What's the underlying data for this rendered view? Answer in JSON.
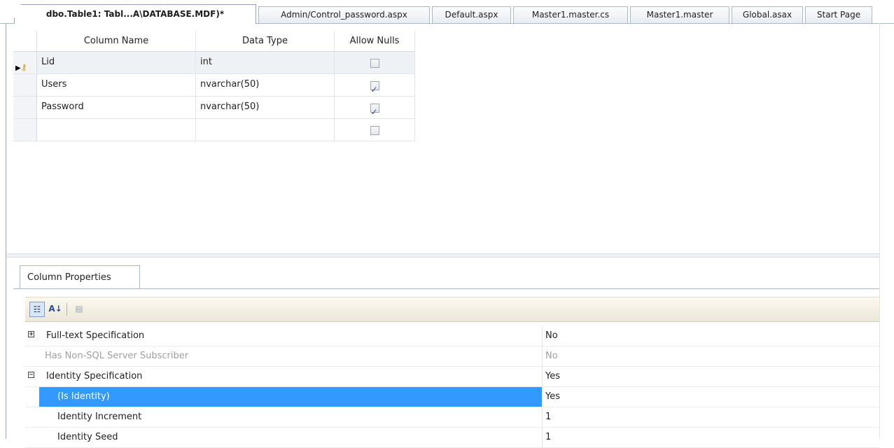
{
  "tabs": [
    {
      "label": "dbo.Table1: Tabl...A\\DATABASE.MDF)*",
      "active": true
    },
    {
      "label": "Admin/Control_password.aspx",
      "active": false
    },
    {
      "label": "Default.aspx",
      "active": false
    },
    {
      "label": "Master1.master.cs",
      "active": false
    },
    {
      "label": "Master1.master",
      "active": false
    },
    {
      "label": "Global.asax",
      "active": false
    },
    {
      "label": "Start Page",
      "active": false
    }
  ],
  "grid": {
    "headers": {
      "name": "Column Name",
      "type": "Data Type",
      "nulls": "Allow Nulls"
    },
    "rows": [
      {
        "name": "Lid",
        "type": "int",
        "allow_nulls": false,
        "primary_key": true,
        "current": true
      },
      {
        "name": "Users",
        "type": "nvarchar(50)",
        "allow_nulls": true,
        "primary_key": false,
        "current": false
      },
      {
        "name": "Password",
        "type": "nvarchar(50)",
        "allow_nulls": true,
        "primary_key": false,
        "current": false
      },
      {
        "name": "",
        "type": "",
        "allow_nulls": false,
        "primary_key": false,
        "current": false
      }
    ]
  },
  "column_properties": {
    "tab_label": "Column Properties",
    "toolbar": {
      "categorized_icon": "categorized-icon",
      "alphabetical_icon": "alphabetical-sort-icon",
      "property_pages_icon": "property-pages-icon"
    },
    "properties": [
      {
        "name": "Full-text Specification",
        "value": "No",
        "kind": "cat",
        "expander": "+",
        "dim": false,
        "selected": false
      },
      {
        "name": "Has Non-SQL Server Subscriber",
        "value": "No",
        "kind": "plain",
        "expander": "",
        "dim": true,
        "selected": false
      },
      {
        "name": "Identity Specification",
        "value": "Yes",
        "kind": "cat",
        "expander": "−",
        "dim": false,
        "selected": false
      },
      {
        "name": "(Is Identity)",
        "value": "Yes",
        "kind": "sub",
        "expander": "",
        "dim": false,
        "selected": true
      },
      {
        "name": "Identity Increment",
        "value": "1",
        "kind": "sub",
        "expander": "",
        "dim": false,
        "selected": false
      },
      {
        "name": "Identity Seed",
        "value": "1",
        "kind": "sub",
        "expander": "",
        "dim": false,
        "selected": false
      }
    ]
  },
  "colors": {
    "selection": "#3399ff",
    "tab_border": "#a9b8cc",
    "toolbar_bg": "#ece7d9"
  }
}
